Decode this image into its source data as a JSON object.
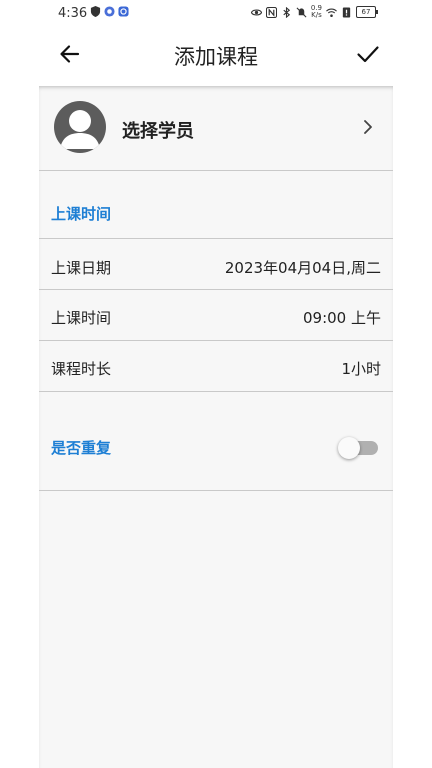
{
  "status_bar": {
    "time": "4:36",
    "net_speed_value": "0.9",
    "net_speed_unit": "K/s",
    "battery": "67"
  },
  "app_bar": {
    "title": "添加课程"
  },
  "student": {
    "label": "选择学员"
  },
  "schedule": {
    "section_title": "上课时间",
    "rows": [
      {
        "label": "上课日期",
        "value": "2023年04月04日,周二"
      },
      {
        "label": "上课时间",
        "value": "09:00 上午"
      },
      {
        "label": "课程时长",
        "value": "1小时"
      }
    ]
  },
  "repeat": {
    "label": "是否重复",
    "enabled": false
  },
  "colors": {
    "accent": "#1e7fd4",
    "content_bg": "#f7f7f7",
    "avatar": "#5c5c5c",
    "toggle_track_off": "#b0b0b0"
  }
}
